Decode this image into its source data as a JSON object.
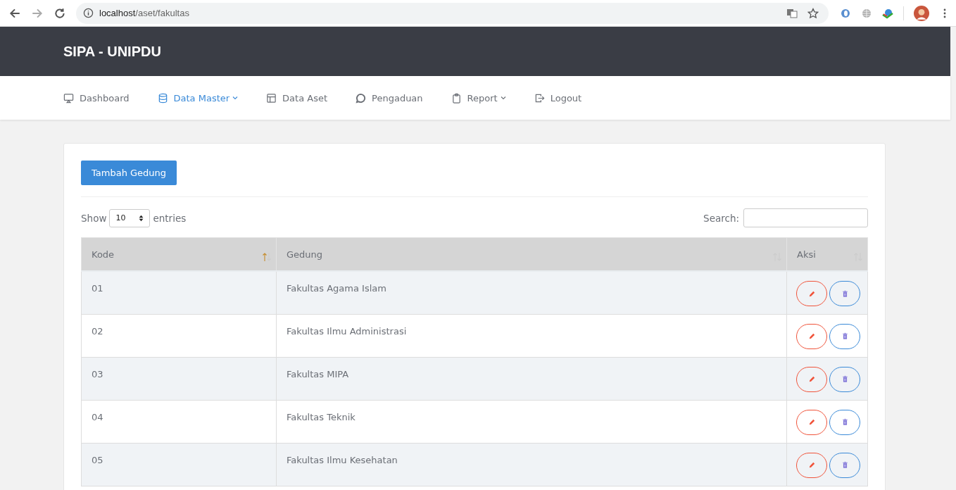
{
  "browser": {
    "url_host": "localhost",
    "url_path": "/aset/fakultas"
  },
  "app": {
    "title": "SIPA - UNIPDU"
  },
  "nav": [
    {
      "label": "Dashboard",
      "selected": false,
      "dropdown": false
    },
    {
      "label": "Data Master",
      "selected": true,
      "dropdown": true
    },
    {
      "label": "Data Aset",
      "selected": false,
      "dropdown": false
    },
    {
      "label": "Pengaduan",
      "selected": false,
      "dropdown": false
    },
    {
      "label": "Report",
      "selected": false,
      "dropdown": true
    },
    {
      "label": "Logout",
      "selected": false,
      "dropdown": false
    }
  ],
  "add_button": "Tambah Gedung",
  "length": {
    "label_before": "Show",
    "value": "10",
    "label_after": "entries"
  },
  "search": {
    "label": "Search:"
  },
  "table": {
    "columns": [
      {
        "label": "Kode",
        "sorted": true
      },
      {
        "label": "Gedung",
        "sorted": false
      },
      {
        "label": "Aksi",
        "sorted": false
      }
    ],
    "rows": [
      {
        "kode": "01",
        "gedung": "Fakultas Agama Islam"
      },
      {
        "kode": "02",
        "gedung": "Fakultas Ilmu Administrasi"
      },
      {
        "kode": "03",
        "gedung": "Fakultas MIPA"
      },
      {
        "kode": "04",
        "gedung": "Fakultas Teknik"
      },
      {
        "kode": "05",
        "gedung": "Fakultas Ilmu Kesehatan"
      }
    ]
  }
}
